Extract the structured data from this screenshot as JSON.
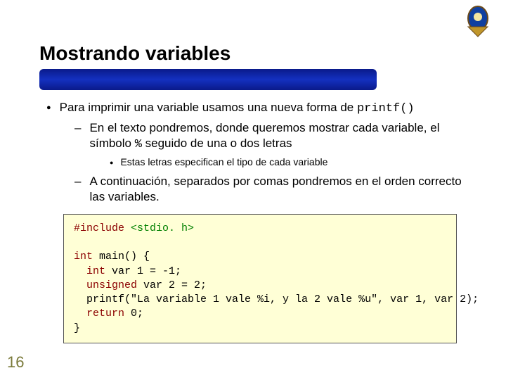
{
  "title": "Mostrando variables",
  "bullet": {
    "main_pre": "Para imprimir una variable usamos una nueva forma de ",
    "main_code": "printf()",
    "sub1_pre": "En el texto pondremos, donde queremos mostrar cada variable, el símbolo ",
    "sub1_code": "%",
    "sub1_post": " seguido de una o dos letras",
    "subsub1": "Estas letras  especifican el tipo de cada variable",
    "sub2": "A continuación, separados por comas pondremos en el orden correcto las variables."
  },
  "code": {
    "l1a": "#include ",
    "l1b": "<stdio. h>",
    "l3a": "int",
    "l3b": " main() {",
    "l4a": "  int",
    "l4b": " var 1 = -1;",
    "l5a": "  unsigned",
    "l5b": " var 2 = 2;",
    "l6": "  printf(\"La variable 1 vale %i, y la 2 vale %u\", var 1, var 2);",
    "l7a": "  return",
    "l7b": " 0;",
    "l8": "}"
  },
  "page_num": "16"
}
